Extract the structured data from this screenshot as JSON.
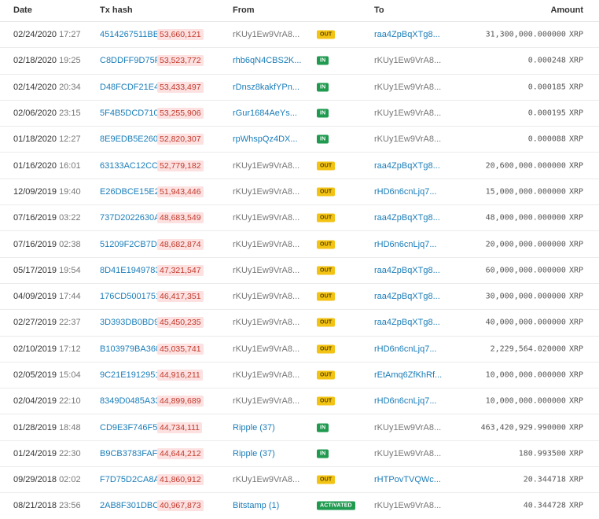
{
  "headers": {
    "date": "Date",
    "hash": "Tx hash",
    "from": "From",
    "to": "To",
    "amount": "Amount"
  },
  "colors": {
    "link": "#1a7db8",
    "ledger_bg": "#fde1e1",
    "ledger_text": "#c0392b",
    "out_badge": "#f3c313",
    "in_badge": "#1f9a4f"
  },
  "rows": [
    {
      "date": "02/24/2020",
      "time": "17:27",
      "hash": "4514267511BB...",
      "ledger": "53,660,121",
      "from": "rKUy1Ew9VrA8...",
      "type": "OUT",
      "to": "raa4ZpBqXTg8...",
      "amount": "31,300,000.000000",
      "currency": "XRP"
    },
    {
      "date": "02/18/2020",
      "time": "19:25",
      "hash": "C8DDFF9D75F...",
      "ledger": "53,523,772",
      "from": "rhb6qN4CBS2K...",
      "type": "IN",
      "to": "rKUy1Ew9VrA8...",
      "amount": "0.000248",
      "currency": "XRP"
    },
    {
      "date": "02/14/2020",
      "time": "20:34",
      "hash": "D48FCDF21E48...",
      "ledger": "53,433,497",
      "from": "rDnsz8kakfYPn...",
      "type": "IN",
      "to": "rKUy1Ew9VrA8...",
      "amount": "0.000185",
      "currency": "XRP"
    },
    {
      "date": "02/06/2020",
      "time": "23:15",
      "hash": "5F4B5DCD710...",
      "ledger": "53,255,906",
      "from": "rGur1684AeYs...",
      "type": "IN",
      "to": "rKUy1Ew9VrA8...",
      "amount": "0.000195",
      "currency": "XRP"
    },
    {
      "date": "01/18/2020",
      "time": "12:27",
      "hash": "8E9EDB5E2606...",
      "ledger": "52,820,307",
      "from": "rpWhspQz4DX...",
      "type": "IN",
      "to": "rKUy1Ew9VrA8...",
      "amount": "0.000088",
      "currency": "XRP"
    },
    {
      "date": "01/16/2020",
      "time": "16:01",
      "hash": "63133AC12CC...",
      "ledger": "52,779,182",
      "from": "rKUy1Ew9VrA8...",
      "type": "OUT",
      "to": "raa4ZpBqXTg8...",
      "amount": "20,600,000.000000",
      "currency": "XRP"
    },
    {
      "date": "12/09/2019",
      "time": "19:40",
      "hash": "E26DBCE15E20...",
      "ledger": "51,943,446",
      "from": "rKUy1Ew9VrA8...",
      "type": "OUT",
      "to": "rHD6n6cnLjq7...",
      "amount": "15,000,000.000000",
      "currency": "XRP"
    },
    {
      "date": "07/16/2019",
      "time": "03:22",
      "hash": "737D2022630A...",
      "ledger": "48,683,549",
      "from": "rKUy1Ew9VrA8...",
      "type": "OUT",
      "to": "raa4ZpBqXTg8...",
      "amount": "48,000,000.000000",
      "currency": "XRP"
    },
    {
      "date": "07/16/2019",
      "time": "02:38",
      "hash": "51209F2CB7D8...",
      "ledger": "48,682,874",
      "from": "rKUy1Ew9VrA8...",
      "type": "OUT",
      "to": "rHD6n6cnLjq7...",
      "amount": "20,000,000.000000",
      "currency": "XRP"
    },
    {
      "date": "05/17/2019",
      "time": "19:54",
      "hash": "8D41E1949783...",
      "ledger": "47,321,547",
      "from": "rKUy1Ew9VrA8...",
      "type": "OUT",
      "to": "raa4ZpBqXTg8...",
      "amount": "60,000,000.000000",
      "currency": "XRP"
    },
    {
      "date": "04/09/2019",
      "time": "17:44",
      "hash": "176CD5001751...",
      "ledger": "46,417,351",
      "from": "rKUy1Ew9VrA8...",
      "type": "OUT",
      "to": "raa4ZpBqXTg8...",
      "amount": "30,000,000.000000",
      "currency": "XRP"
    },
    {
      "date": "02/27/2019",
      "time": "22:37",
      "hash": "3D393DB0BD9...",
      "ledger": "45,450,235",
      "from": "rKUy1Ew9VrA8...",
      "type": "OUT",
      "to": "raa4ZpBqXTg8...",
      "amount": "40,000,000.000000",
      "currency": "XRP"
    },
    {
      "date": "02/10/2019",
      "time": "17:12",
      "hash": "B103979BA360...",
      "ledger": "45,035,741",
      "from": "rKUy1Ew9VrA8...",
      "type": "OUT",
      "to": "rHD6n6cnLjq7...",
      "amount": "2,229,564.020000",
      "currency": "XRP"
    },
    {
      "date": "02/05/2019",
      "time": "15:04",
      "hash": "9C21E1912951...",
      "ledger": "44,916,211",
      "from": "rKUy1Ew9VrA8...",
      "type": "OUT",
      "to": "rEtAmq6ZfKhRf...",
      "amount": "10,000,000.000000",
      "currency": "XRP"
    },
    {
      "date": "02/04/2019",
      "time": "22:10",
      "hash": "8349D0485A33...",
      "ledger": "44,899,689",
      "from": "rKUy1Ew9VrA8...",
      "type": "OUT",
      "to": "rHD6n6cnLjq7...",
      "amount": "10,000,000.000000",
      "currency": "XRP"
    },
    {
      "date": "01/28/2019",
      "time": "18:48",
      "hash": "CD9E3F746F52...",
      "ledger": "44,734,111",
      "from": "Ripple (37)",
      "type": "IN",
      "to": "rKUy1Ew9VrA8...",
      "amount": "463,420,929.990000",
      "currency": "XRP"
    },
    {
      "date": "01/24/2019",
      "time": "22:30",
      "hash": "B9CB3783FAF5...",
      "ledger": "44,644,212",
      "from": "Ripple (37)",
      "type": "IN",
      "to": "rKUy1Ew9VrA8...",
      "amount": "180.993500",
      "currency": "XRP"
    },
    {
      "date": "09/29/2018",
      "time": "02:02",
      "hash": "F7D75D2CA8A...",
      "ledger": "41,860,912",
      "from": "rKUy1Ew9VrA8...",
      "type": "OUT",
      "to": "rHTPovTVQWc...",
      "amount": "20.344718",
      "currency": "XRP"
    },
    {
      "date": "08/21/2018",
      "time": "23:56",
      "hash": "2AB8F301DBC...",
      "ledger": "40,967,873",
      "from": "Bitstamp (1)",
      "type": "ACTIVATED",
      "to": "rKUy1Ew9VrA8...",
      "amount": "40.344728",
      "currency": "XRP"
    }
  ]
}
